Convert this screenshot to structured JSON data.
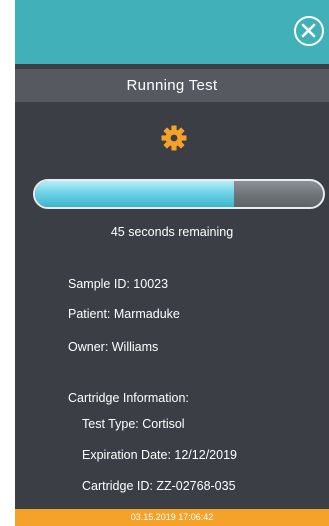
{
  "header": {
    "close_icon": "close-icon",
    "title": "Running Test",
    "colors": {
      "top_bar": "#41b0b8",
      "title_bar": "#56595f",
      "background": "#3b3e44",
      "footer": "#f5a22a",
      "gear": "#f5a22a",
      "progress_fill": "#6fd3e6"
    }
  },
  "status": {
    "icon": "gear-icon",
    "progress_fraction": 0.69,
    "remaining_text": "45 seconds remaining"
  },
  "details": {
    "sample_id": "Sample ID: 10023",
    "patient": "Patient: Marmaduke",
    "owner": "Owner: Williams"
  },
  "cartridge": {
    "heading": "Cartridge Information:",
    "test_type": "Test Type: Cortisol",
    "expiration": "Expiration Date: 12/12/2019",
    "cartridge_id": "Cartridge ID: ZZ-02768-035"
  },
  "footer": {
    "datetime": "03.15.2019  17:06:42"
  }
}
